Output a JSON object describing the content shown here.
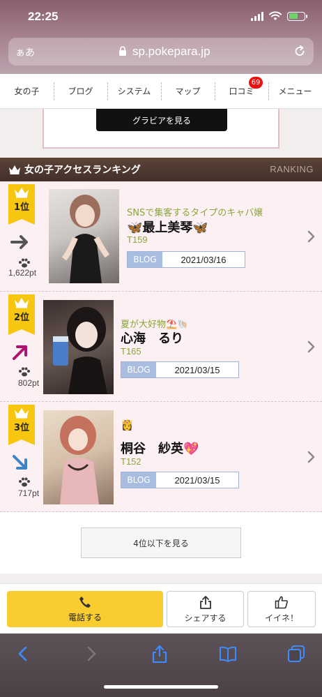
{
  "status": {
    "time": "22:25",
    "battery_level": 0.6
  },
  "browser": {
    "aa_label": "ぁあ",
    "url": "sp.pokepara.jp"
  },
  "nav": {
    "items": [
      "女の子",
      "ブログ",
      "システム",
      "マップ",
      "口コミ",
      "メニュー"
    ],
    "reviews_badge": "69"
  },
  "upper_card": {
    "gravure_button": "グラビアを見る"
  },
  "ranking": {
    "title": "女の子アクセスランキング",
    "title_en": "RANKING",
    "entries": [
      {
        "rank": "1位",
        "trend": "flat",
        "points": "1,622pt",
        "catch": "SNSで集客するタイプのキャバ嬢",
        "name": "🦋最上美琴🦋",
        "height": "T159",
        "blog_label": "BLOG",
        "blog_date": "2021/03/16"
      },
      {
        "rank": "2位",
        "trend": "up",
        "points": "802pt",
        "catch": "夏が大好物⛱️🐚",
        "name": "心海　るり",
        "height": "T165",
        "blog_label": "BLOG",
        "blog_date": "2021/03/15"
      },
      {
        "rank": "3位",
        "trend": "down",
        "points": "717pt",
        "catch": "👸",
        "name": "桐谷　紗英💖",
        "height": "T152",
        "blog_label": "BLOG",
        "blog_date": "2021/03/15"
      }
    ],
    "more_button": "4位以下を見る"
  },
  "actions": {
    "call": "電話する",
    "share": "シェアする",
    "like": "イイネ！"
  },
  "colors": {
    "accent_yellow": "#f6c611",
    "catch_green": "#8aa53b",
    "header_brown": "#4b362d",
    "row_pink": "#fdf0f3"
  }
}
